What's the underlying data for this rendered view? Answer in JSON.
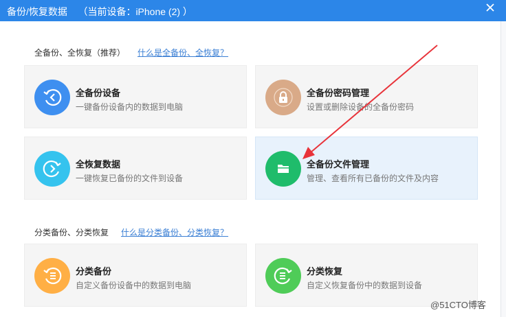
{
  "window": {
    "title": "备份/恢复数据    （当前设备：iPhone (2) ）",
    "close_icon": "close-icon"
  },
  "section_full": {
    "title": "全备份、全恢复（推荐）",
    "help_link": "什么是全备份、全恢复？",
    "cards": [
      {
        "title": "全备份设备",
        "desc": "一键备份设备内的数据到电脑",
        "icon": "backup-clock-icon",
        "color": "#3e8ff0"
      },
      {
        "title": "全备份密码管理",
        "desc": "设置或删除设备的全备份密码",
        "icon": "lock-icon",
        "color": "#d9aa88"
      },
      {
        "title": "全恢复数据",
        "desc": "一键恢复已备份的文件到设备",
        "icon": "restore-clock-icon",
        "color": "#35c3ee"
      },
      {
        "title": "全备份文件管理",
        "desc": "管理、查看所有已备份的文件及内容",
        "icon": "folder-icon",
        "color": "#1fbc6b"
      }
    ]
  },
  "section_category": {
    "title": "分类备份、分类恢复",
    "help_link": "什么是分类备份、分类恢复？",
    "cards": [
      {
        "title": "分类备份",
        "desc": "自定义备份设备中的数据到电脑",
        "icon": "category-backup-icon",
        "color": "#ffaf45"
      },
      {
        "title": "分类恢复",
        "desc": "自定义恢复备份中的数据到设备",
        "icon": "category-restore-icon",
        "color": "#4fcc58"
      }
    ]
  },
  "annotation": {
    "arrow_color": "#e8333a"
  },
  "watermark": "@51CTO博客"
}
